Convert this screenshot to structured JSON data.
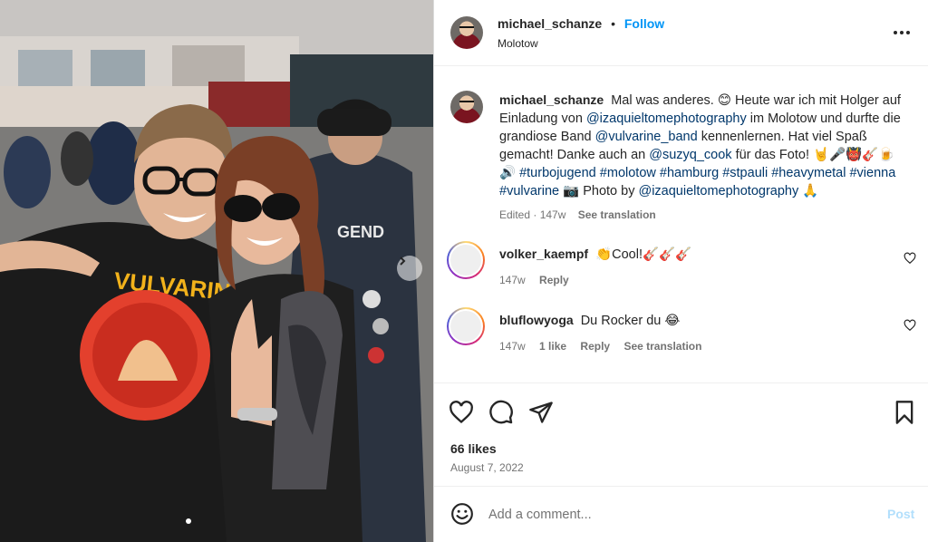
{
  "post": {
    "author": "michael_schanze",
    "follow_label": "Follow",
    "separator": "•",
    "location": "Molotow",
    "more_icon": "more-horizontal-icon"
  },
  "caption": {
    "username": "michael_schanze",
    "t1": "Mal was anderes. 😊 Heute war ich mit Holger auf Einladung von",
    "m1": "@izaquieltomephotography",
    "t2": "im Molotow und durfte die grandiose Band",
    "m2": "@vulvarine_band",
    "t3": "kennenlernen. Hat viel Spaß gemacht! Danke auch an",
    "m3": "@suzyq_cook",
    "t4": "für das Foto! 🤘🎤👹🎸🍺🔊",
    "tags": [
      "#turbojugend",
      "#molotow",
      "#hamburg",
      "#stpauli",
      "#heavymetal",
      "#vienna",
      "#vulvarine"
    ],
    "t5": "📷 Photo by",
    "m4": "@izaquieltomephotography",
    "t6": "🙏",
    "edited": "Edited · 147w",
    "see_translation": "See translation"
  },
  "comments": [
    {
      "username": "volker_kaempf",
      "text": "👏Cool!🎸🎸🎸",
      "age": "147w",
      "reply": "Reply"
    },
    {
      "username": "bluflowyoga",
      "text": "Du Rocker du 😂",
      "age": "147w",
      "likes": "1 like",
      "reply": "Reply",
      "see_translation": "See translation"
    }
  ],
  "engagement": {
    "likes": "66 likes",
    "date": "August 7, 2022"
  },
  "comment_box": {
    "placeholder": "Add a comment...",
    "post_label": "Post"
  },
  "photo": {
    "shirt_text": "VULVARINE",
    "background_sign": "GEND"
  },
  "colors": {
    "follow": "#0095f6",
    "mention": "#00376b",
    "post_disabled": "#b2dffc",
    "muted": "#737373"
  }
}
